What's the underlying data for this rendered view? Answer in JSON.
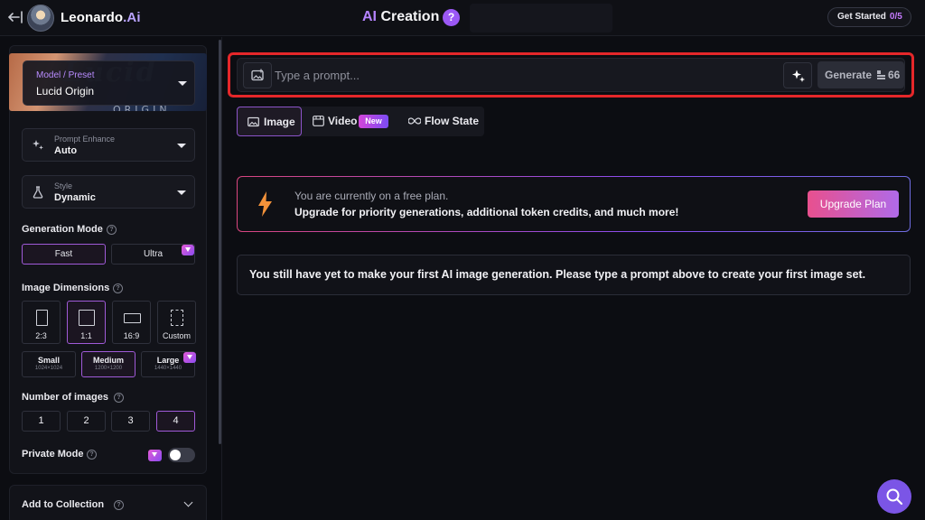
{
  "header": {
    "brand_name": "Leonardo",
    "brand_suffix": ".Ai",
    "title_accent": "AI",
    "title_main": " Creation",
    "help_badge": "?",
    "get_started_label": "Get Started",
    "get_started_count": "0/5"
  },
  "sidebar": {
    "model": {
      "label": "Model / Preset",
      "value": "Lucid Origin",
      "banner_text": "ORIGIN"
    },
    "prompt_enhance": {
      "label": "Prompt Enhance",
      "value": "Auto"
    },
    "style": {
      "label": "Style",
      "value": "Dynamic"
    },
    "generation_mode": {
      "label": "Generation Mode",
      "options": [
        "Fast",
        "Ultra"
      ],
      "selected": "Fast"
    },
    "image_dimensions": {
      "label": "Image Dimensions",
      "ratios": [
        "2:3",
        "1:1",
        "16:9",
        "Custom"
      ],
      "selected_ratio": "1:1",
      "sizes": [
        {
          "name": "Small",
          "res": "1024×1024"
        },
        {
          "name": "Medium",
          "res": "1200×1200"
        },
        {
          "name": "Large",
          "res": "1440×1440"
        }
      ],
      "selected_size": "Medium"
    },
    "number_of_images": {
      "label": "Number of images",
      "options": [
        "1",
        "2",
        "3",
        "4"
      ],
      "selected": "4"
    },
    "private_mode": {
      "label": "Private Mode",
      "enabled": false
    },
    "add_to_collection": "Add to Collection"
  },
  "prompt": {
    "placeholder": "Type a prompt...",
    "value": "",
    "generate_label": "Generate",
    "token_cost": "66"
  },
  "tabs": [
    {
      "label": "Image",
      "active": true
    },
    {
      "label": "Video",
      "badge": "New"
    },
    {
      "label": "Flow State"
    }
  ],
  "upgrade": {
    "line1": "You are currently on a free plan.",
    "line2": "Upgrade for priority generations, additional token credits, and much more!",
    "button": "Upgrade Plan"
  },
  "empty_state": "You still have yet to make your first AI image generation. Please type a prompt above to create your first image set.",
  "colors": {
    "accent_purple": "#9b58f5",
    "highlight_red": "#e5272a",
    "upgrade_gradient_start": "#e8508e",
    "upgrade_gradient_end": "#b06ae8"
  }
}
